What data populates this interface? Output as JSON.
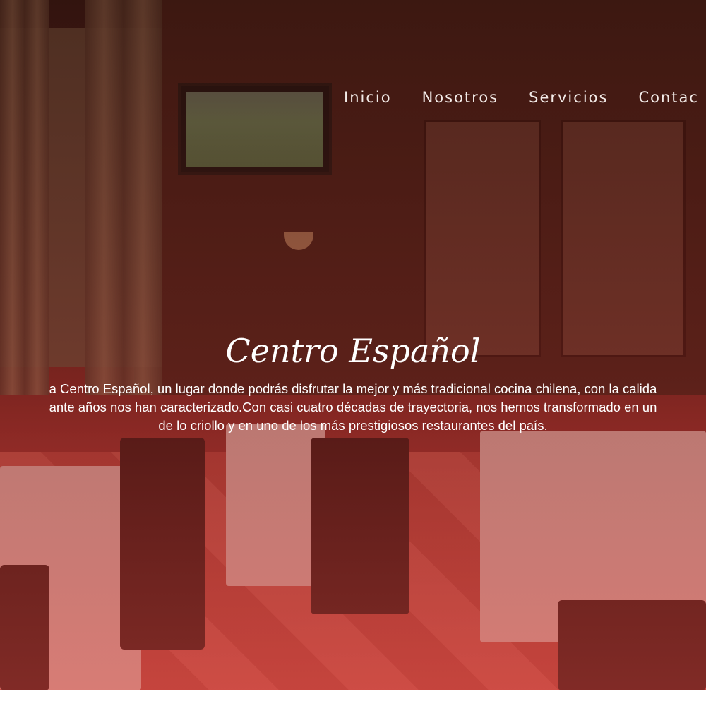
{
  "nav": {
    "items": [
      {
        "label": "Inicio"
      },
      {
        "label": "Nosotros"
      },
      {
        "label": "Servicios"
      },
      {
        "label": "Contac"
      }
    ]
  },
  "hero": {
    "title": "Centro Español",
    "lines": [
      "a Centro Español, un lugar donde podrás disfrutar la mejor y más tradicional cocina chilena, con la calida",
      "ante años nos han caracterizado.Con casi cuatro décadas de trayectoria, nos hemos transformado en un",
      "de lo criollo y en uno de los más prestigiosos restaurantes del país."
    ]
  },
  "colors": {
    "accent": "#c24742",
    "text": "#ffffff"
  }
}
